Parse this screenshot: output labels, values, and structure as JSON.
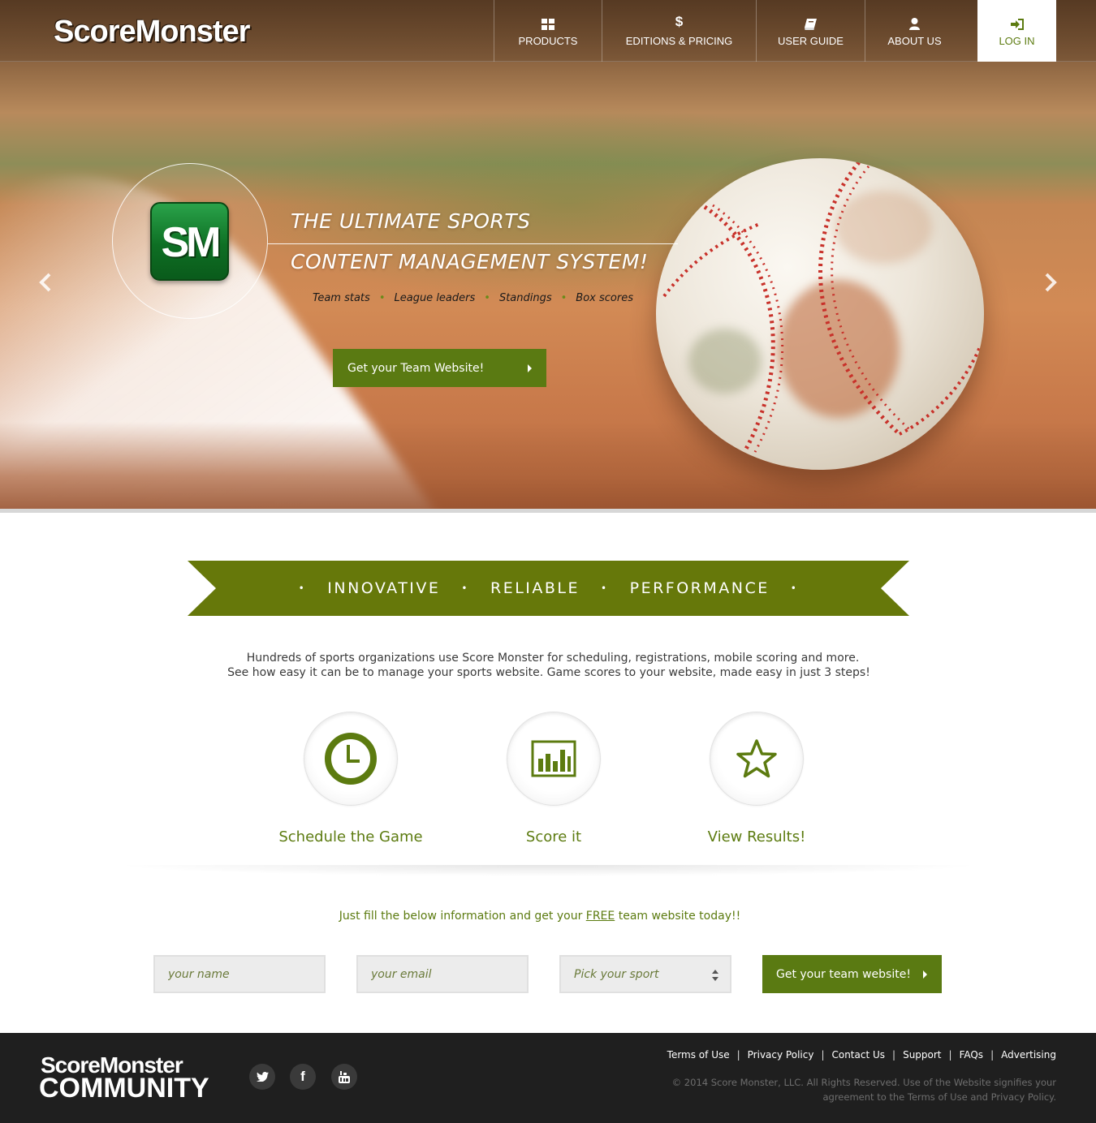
{
  "header": {
    "logo": "ScoreMonster",
    "nav": [
      {
        "label": "PRODUCTS",
        "icon": "grid-icon"
      },
      {
        "label": "EDITIONS & PRICING",
        "icon": "dollar-icon"
      },
      {
        "label": "USER GUIDE",
        "icon": "book-icon"
      },
      {
        "label": "ABOUT US",
        "icon": "user-icon"
      },
      {
        "label": "LOG IN",
        "icon": "login-icon"
      }
    ]
  },
  "hero": {
    "badge": "SM",
    "headline_1": "THE ULTIMATE SPORTS",
    "headline_2": "CONTENT MANAGEMENT SYSTEM!",
    "features": [
      "Team stats",
      "League leaders",
      "Standings",
      "Box scores"
    ],
    "cta": "Get your Team Website!"
  },
  "banner": {
    "words": [
      "INNOVATIVE",
      "RELIABLE",
      "PERFORMANCE"
    ]
  },
  "intro": {
    "line_1": "Hundreds of sports organizations use Score Monster for scheduling, registrations, mobile scoring and more.",
    "line_2": "See how easy it can be to manage your sports website. Game scores to your website, made easy in just 3 steps!"
  },
  "steps": [
    {
      "label": "Schedule the Game",
      "icon": "clock-icon"
    },
    {
      "label": "Score it",
      "icon": "bar-chart-icon"
    },
    {
      "label": "View Results!",
      "icon": "star-icon"
    }
  ],
  "signup": {
    "intro_before": "Just fill the below information and get your ",
    "intro_free": "FREE",
    "intro_after": " team website today!!",
    "name_placeholder": "your name",
    "email_placeholder": "your email",
    "sport_placeholder": "Pick your sport",
    "submit": "Get your team website!"
  },
  "footer": {
    "logo_line_1": "ScoreMonster",
    "logo_line_2": "COMMUNITY",
    "social": [
      "twitter-icon",
      "facebook-icon",
      "youtube-icon"
    ],
    "links": [
      "Terms of Use",
      "Privacy Policy",
      "Contact Us",
      "Support",
      "FAQs",
      "Advertising"
    ],
    "copyright_1": "© 2014 Score Monster, LLC. All Rights Reserved. Use of the Website signifies your",
    "copyright_2": "agreement to the Terms of Use and Privacy Policy."
  },
  "colors": {
    "accent": "#5a7a12",
    "banner": "#66780a",
    "footer_bg": "#1f1f1f"
  }
}
